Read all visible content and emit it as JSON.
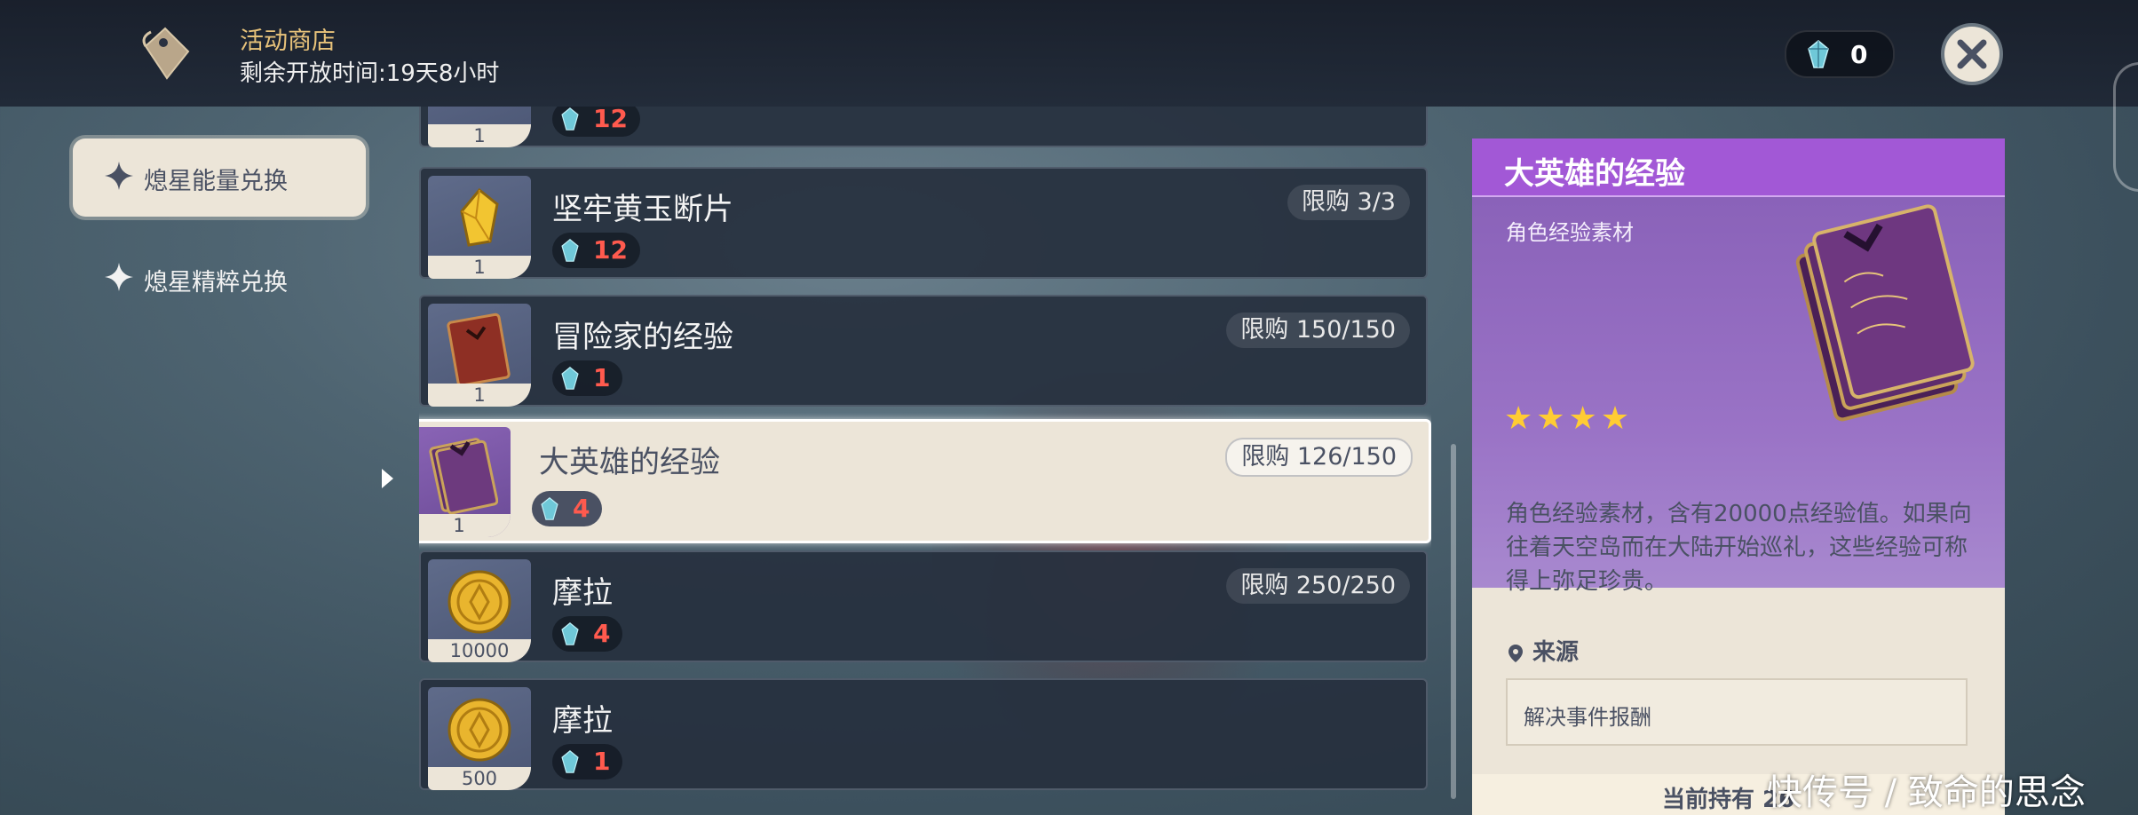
{
  "header": {
    "shop_title": "活动商店",
    "remaining_time": "剩余开放时间:19天8小时",
    "currency_amount": "0",
    "currency_icon": "crystal-icon",
    "close_icon": "close-icon"
  },
  "nav": {
    "items": [
      {
        "label": "熄星能量兑换",
        "active": true
      },
      {
        "label": "熄星精粹兑换",
        "active": false
      }
    ]
  },
  "shop_list": [
    {
      "name": "",
      "quantity": "1",
      "price": "12",
      "limit": ""
    },
    {
      "name": "坚牢黄玉断片",
      "quantity": "1",
      "price": "12",
      "limit": "限购 3/3"
    },
    {
      "name": "冒险家的经验",
      "quantity": "1",
      "price": "1",
      "limit": "限购 150/150"
    },
    {
      "name": "大英雄的经验",
      "quantity": "1",
      "price": "4",
      "limit": "限购 126/150",
      "selected": true
    },
    {
      "name": "摩拉",
      "quantity": "10000",
      "price": "4",
      "limit": "限购 250/250"
    },
    {
      "name": "摩拉",
      "quantity": "500",
      "price": "1",
      "limit": ""
    }
  ],
  "detail": {
    "title": "大英雄的经验",
    "category": "角色经验素材",
    "rarity_stars": "★★★★",
    "rarity": 4,
    "description": "角色经验素材，含有20000点经验值。如果向往着天空岛而在大陆开始巡礼，这些经验可称得上弥足珍贵。",
    "source_heading": "来源",
    "source": "解决事件报酬",
    "holding_label": "当前持有 26"
  },
  "watermark": "快传号 / 致命的思念",
  "colors": {
    "accent_gold": "#e7c27a",
    "panel_bg": "#ece5d8",
    "header_purple": "#a258d6",
    "price_red": "#ff5a4e"
  }
}
